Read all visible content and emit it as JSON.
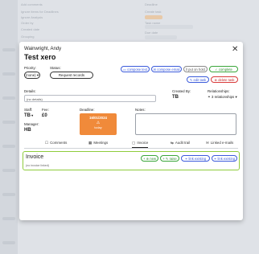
{
  "background": {
    "lines": [
      "Add comments",
      "Ignore items for Deadlines",
      "Ignore Analysis",
      "Order by",
      "Created date",
      "Grouping"
    ],
    "right_lines": [
      "Deadline",
      "Create task",
      "Task name",
      "Due date"
    ]
  },
  "modal": {
    "client_name": "Wainwright, Andy",
    "title": "Test xero",
    "close_label": "✕",
    "priority": {
      "label": "Priority:",
      "value": "(none)"
    },
    "status": {
      "label": "Status:",
      "value": "Request records"
    },
    "actions": {
      "compose_text": "compose text",
      "compose_email": "compose email",
      "put_on_hold": "put on hold",
      "complete": "complete",
      "edit_task": "edit task",
      "delete_task": "delete task"
    },
    "details": {
      "label": "Details:",
      "value": "(no details)"
    },
    "created_by": {
      "label": "Created By:",
      "value": "TB"
    },
    "relationships": {
      "label": "Relationships:",
      "value": "3 relationships"
    },
    "staff": {
      "label": "Staff:",
      "value": "TB"
    },
    "fee": {
      "label": "Fee:",
      "value": "£0"
    },
    "manager": {
      "label": "Manager:",
      "value": "HB"
    },
    "deadline": {
      "label": "Deadline:",
      "date": "16/01/2024",
      "icon": "⚠",
      "note": "today"
    },
    "notes": {
      "label": "Notes:"
    },
    "tabs": [
      {
        "label": "Comments",
        "icon": "comment-icon",
        "glyph": "☐"
      },
      {
        "label": "Meetings",
        "icon": "calendar-icon",
        "glyph": "▦"
      },
      {
        "label": "Invoice",
        "icon": "invoice-icon",
        "glyph": "▢"
      },
      {
        "label": "Audit trail",
        "icon": "audit-icon",
        "glyph": "⇆"
      },
      {
        "label": "Linked e-mails",
        "icon": "mail-icon",
        "glyph": "✉"
      }
    ],
    "invoice": {
      "title": "Invoice",
      "empty_text": "(no invoice linked)",
      "buttons": {
        "new": "new",
        "raise": "raise",
        "link_existing_1": "link existing",
        "link_existing_2": "link existing"
      }
    },
    "colors": {
      "accent_blue": "#3b5bdb",
      "deadline_orange": "#f08a3a",
      "invoice_border": "#8fcc3c",
      "complete_green": "#3aa63a",
      "delete_red": "#d93a3a"
    }
  }
}
